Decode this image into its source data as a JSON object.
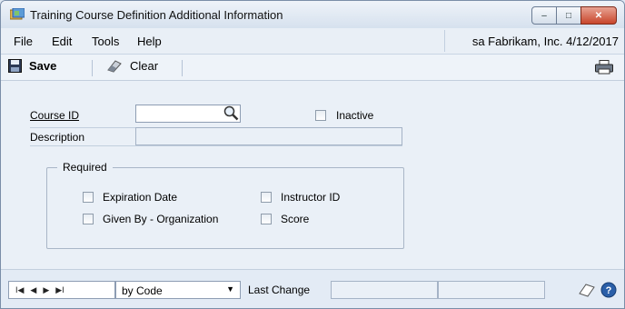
{
  "window": {
    "title": "Training Course Definition Additional Information",
    "controls": {
      "minimize": "–",
      "maximize": "□",
      "close": "✕"
    }
  },
  "menu": {
    "items": [
      "File",
      "Edit",
      "Tools",
      "Help"
    ]
  },
  "user_info": "sa  Fabrikam, Inc.  4/12/2017",
  "toolbar": {
    "save_label": "Save",
    "clear_label": "Clear"
  },
  "form": {
    "course_id_label": "Course ID",
    "course_id_value": "",
    "inactive_label": "Inactive",
    "inactive_checked": false,
    "description_label": "Description",
    "description_value": ""
  },
  "required": {
    "title": "Required",
    "items": [
      {
        "label": "Expiration Date",
        "checked": false
      },
      {
        "label": "Instructor ID",
        "checked": false
      },
      {
        "label": "Given By - Organization",
        "checked": false
      },
      {
        "label": "Score",
        "checked": false
      }
    ]
  },
  "footer": {
    "nav": {
      "first": "I◀",
      "prev": "◀",
      "next": "▶",
      "last": "▶I"
    },
    "sort_by": "by Code",
    "last_change_label": "Last Change"
  },
  "colors": {
    "accent": "#2b5fa8",
    "close": "#c8452b"
  }
}
